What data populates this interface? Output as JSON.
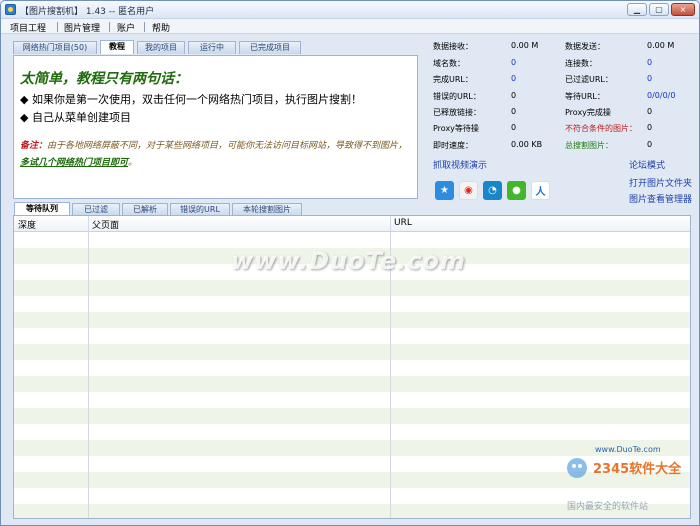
{
  "window": {
    "title": "【图片搜割机】 1.43 -- 匿名用户",
    "min": "0",
    "max": "□",
    "close": "×"
  },
  "menu": [
    "项目工程",
    "图片管理",
    "账户",
    "帮助"
  ],
  "top_tabs": [
    "网络热门项目(50)",
    "教程",
    "我的项目",
    "运行中",
    "已完成项目"
  ],
  "tutorial": {
    "headline": "太简单，教程只有两句话：",
    "bullet1": "◆ 如果你是第一次使用，双击任何一个网络热门项目，执行图片搜割！",
    "bullet2": "◆ 自己从菜单创建项目",
    "note_label": "备注：",
    "note_text": "由于各地网络屏蔽不同，对于某些网络项目，可能你无法访问目标网站，导致得不到图片，",
    "note_link": "多试几个网络热门项目即可",
    "note_end": "。"
  },
  "stats_left": [
    {
      "label": "数据接收：",
      "value": "0.00 M"
    },
    {
      "label": "域名数：",
      "value": "0"
    },
    {
      "label": "完成URL：",
      "value": "0"
    },
    {
      "label": "错误的URL：",
      "value": "0"
    },
    {
      "label": "已释放链接：",
      "value": "0"
    },
    {
      "label": "Proxy等待操",
      "value": "0"
    },
    {
      "label": "即时速度：",
      "value": "0.00 KB"
    }
  ],
  "stats_right": [
    {
      "label": "数据发送：",
      "value": "0.00 M"
    },
    {
      "label": "连接数：",
      "value": "0"
    },
    {
      "label": "已过滤URL：",
      "value": "0"
    },
    {
      "label": "等待URL：",
      "value": "0/0/0/0"
    },
    {
      "label": "Proxy完成操",
      "value": "0"
    },
    {
      "label": "不符合条件的图片：",
      "value": "0"
    },
    {
      "label": "总搜割图片：",
      "value": "0"
    }
  ],
  "links": {
    "video": "抓取视频演示",
    "forum": "论坛模式",
    "open_folder": "打开图片文件夹",
    "viewer": "图片查看管理器"
  },
  "share_icons": [
    "qzone-icon",
    "weibo-icon",
    "tencent-weibo-icon",
    "wechat-icon",
    "renren-icon"
  ],
  "bottom_tabs": [
    "等待队列",
    "已过滤",
    "已解析",
    "错误的URL",
    "本轮搜割图片"
  ],
  "table": {
    "columns": [
      "深度",
      "父页面",
      "URL"
    ]
  },
  "watermark": {
    "main": "www.DuoTe.com",
    "small": "www.DuoTe.com",
    "brand": "2345软件大全",
    "brand_sub": "国内最安全的软件站"
  },
  "colors": {
    "headline": "#1f6b0d",
    "link": "#1f3fa6",
    "value_blue": "#1433c8",
    "warning_red": "#c01818",
    "row_alt": "#eef5e8"
  }
}
